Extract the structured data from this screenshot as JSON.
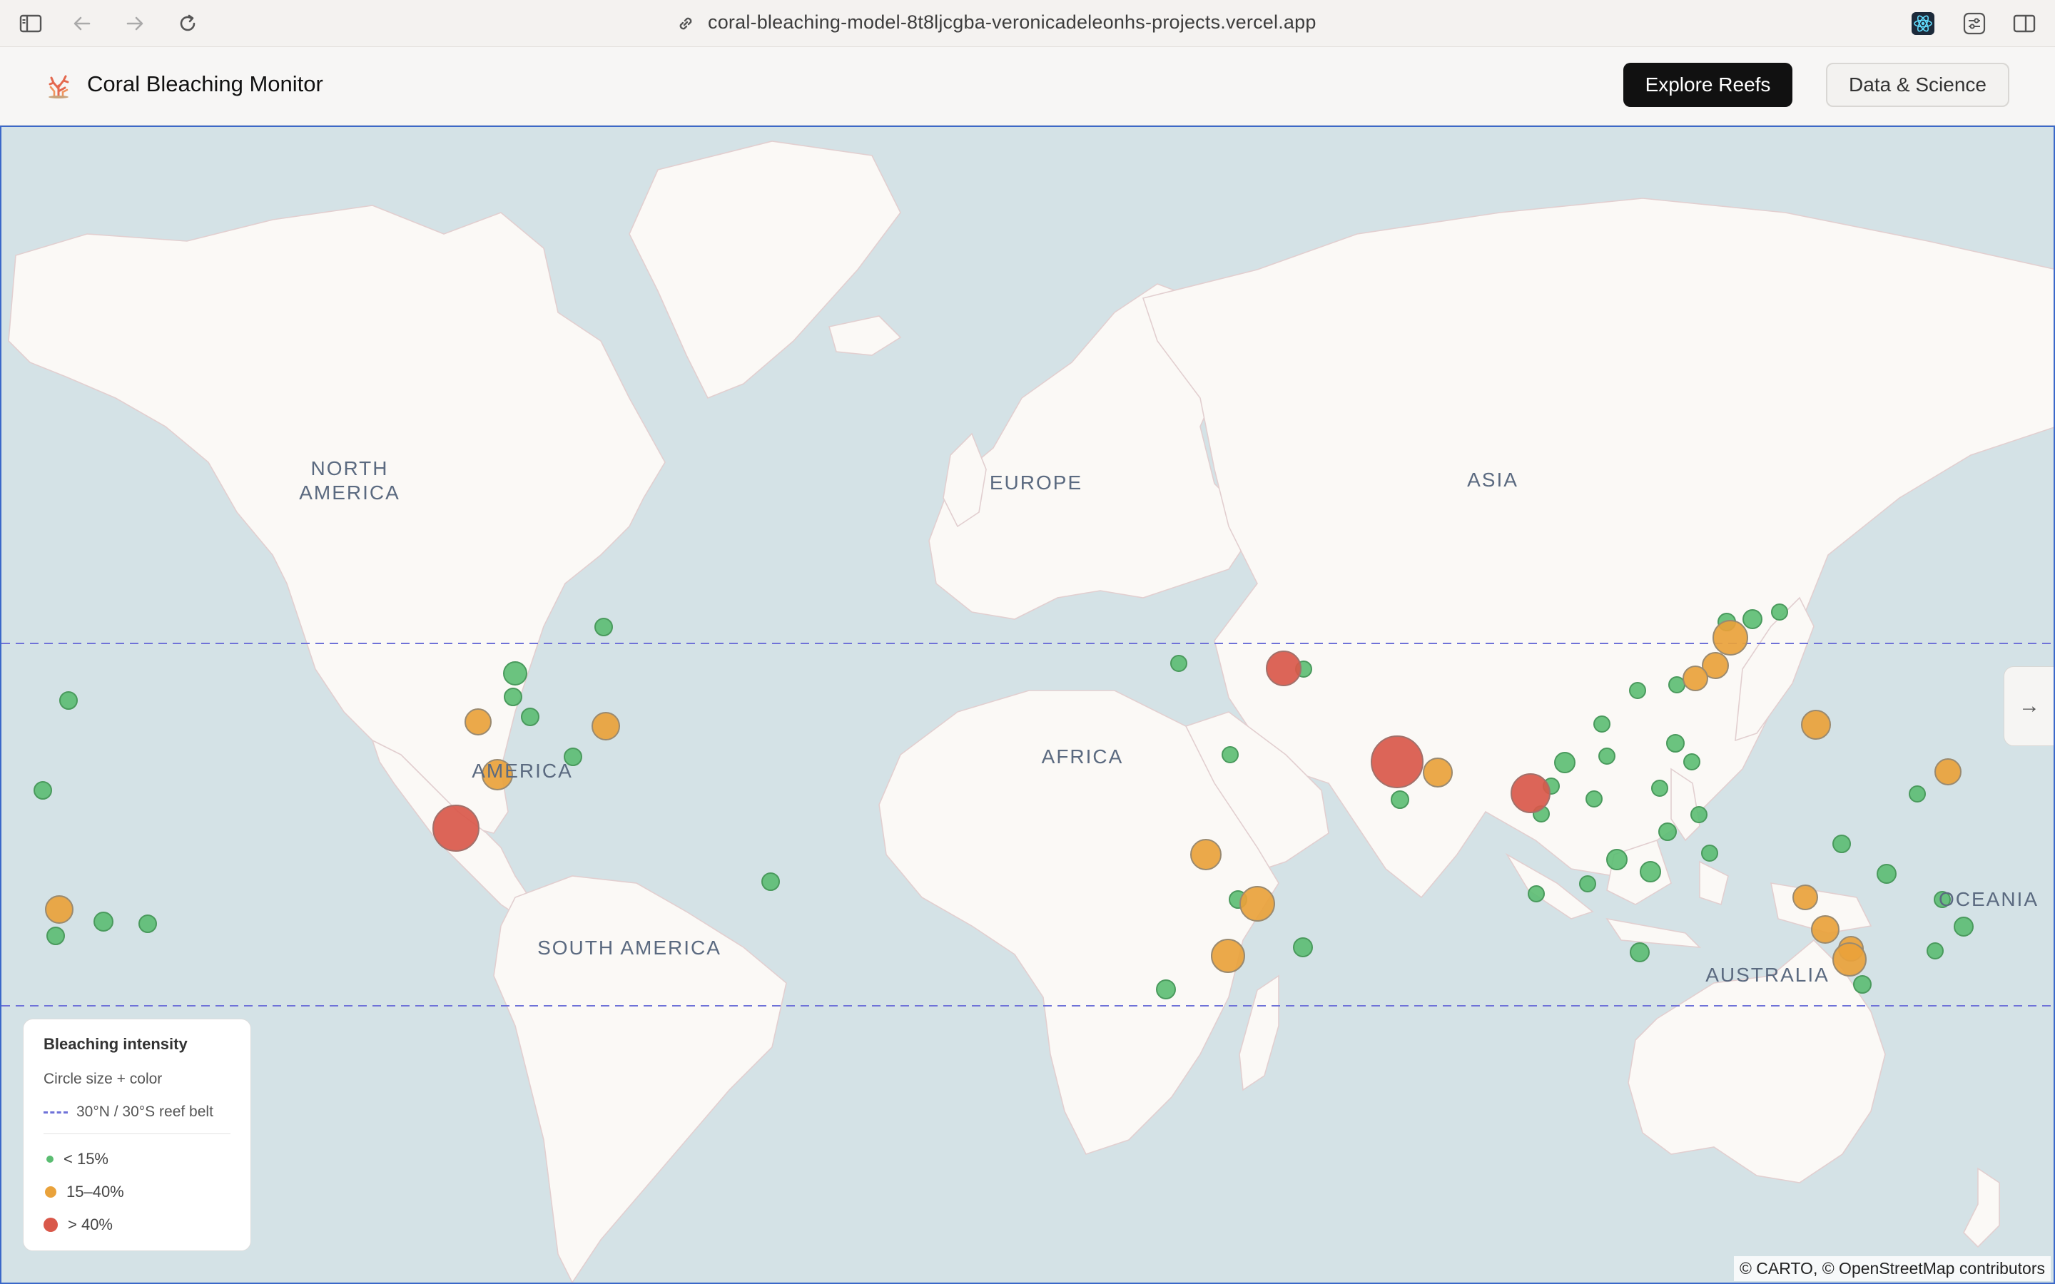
{
  "browser": {
    "url": "coral-bleaching-model-8t8ljcgba-veronicadeleonhs-projects.vercel.app"
  },
  "header": {
    "title": "Coral Bleaching Monitor",
    "explore_label": "Explore Reefs",
    "science_label": "Data & Science"
  },
  "map": {
    "labels": {
      "north_america": "NORTH\nAMERICA",
      "south_america": "SOUTH AMERICA",
      "america": "AMERICA",
      "europe": "EUROPE",
      "asia": "ASIA",
      "africa": "AFRICA",
      "australia": "AUSTRALIA",
      "oceania": "OCEANIA"
    },
    "attribution": "© CARTO, © OpenStreetMap contributors",
    "colors": {
      "ocean": "#d4e2e6",
      "land": "#fbf9f6",
      "low": "#5bbd72",
      "medium": "#e9a23b",
      "high": "#d9584a",
      "belt": "#6f72d8"
    }
  },
  "legend": {
    "title": "Bleaching intensity",
    "subtitle": "Circle size + color",
    "belt_label": "30°N / 30°S reef belt",
    "low_label": "< 15%",
    "medium_label": "15–40%",
    "high_label": "> 40%"
  }
}
